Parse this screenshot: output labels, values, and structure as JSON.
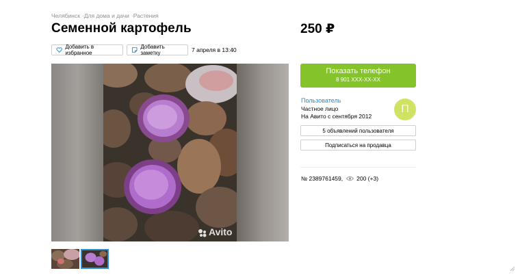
{
  "breadcrumb": {
    "items": [
      "Челябинск",
      "Для дома и дачи",
      "Растения"
    ],
    "separator": "·"
  },
  "listing": {
    "title": "Семенной картофель",
    "price": "250 ₽",
    "date": "7 апреля в 13:40",
    "number": "№ 2389761459,",
    "views": "200 (+3)"
  },
  "actions": {
    "favorite_label": "Добавить в избранное",
    "note_label": "Добавить заметку"
  },
  "gallery": {
    "watermark": "Avito",
    "thumbnails_count": 2,
    "selected_thumbnail": 2
  },
  "contact": {
    "show_phone_label": "Показать телефон",
    "phone_masked": "8 901 XXX-XX-XX"
  },
  "seller": {
    "name": "Пользователь",
    "type": "Частное лицо",
    "since": "На Авито с сентября 2012",
    "avatar_letter": "П",
    "ads_button": "5 объявлений пользователя",
    "subscribe_button": "Подписаться на продавца"
  },
  "colors": {
    "accent_green": "#84c32a",
    "link_blue": "#2a8bd0",
    "avatar_bg": "#cfe264"
  },
  "icons": [
    "heart-icon",
    "note-icon",
    "eye-icon",
    "avito-logo-icon"
  ]
}
